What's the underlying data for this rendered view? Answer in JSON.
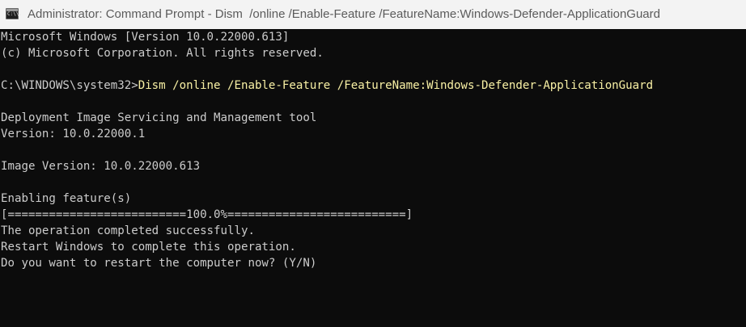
{
  "window": {
    "title": "Administrator: Command Prompt - Dism  /online /Enable-Feature /FeatureName:Windows-Defender-ApplicationGuard",
    "icon": "cmd-icon",
    "icon_glyph": "C:\\\\.",
    "background_color": "#0c0c0c",
    "text_color": "#cccccc",
    "command_color": "#f9f1a5"
  },
  "console": {
    "header_line1": "Microsoft Windows [Version 10.0.22000.613]",
    "header_line2": "(c) Microsoft Corporation. All rights reserved.",
    "prompt": "C:\\WINDOWS\\system32>",
    "command": "Dism /online /Enable-Feature /FeatureName:Windows-Defender-ApplicationGuard",
    "tool_name": "Deployment Image Servicing and Management tool",
    "tool_version": "Version: 10.0.22000.1",
    "image_version": "Image Version: 10.0.22000.613",
    "enabling": "Enabling feature(s)",
    "progress_bar": "[==========================100.0%==========================]",
    "progress_percent": 100.0,
    "success": "The operation completed successfully.",
    "restart_notice": "Restart Windows to complete this operation.",
    "restart_question": "Do you want to restart the computer now? (Y/N)"
  }
}
